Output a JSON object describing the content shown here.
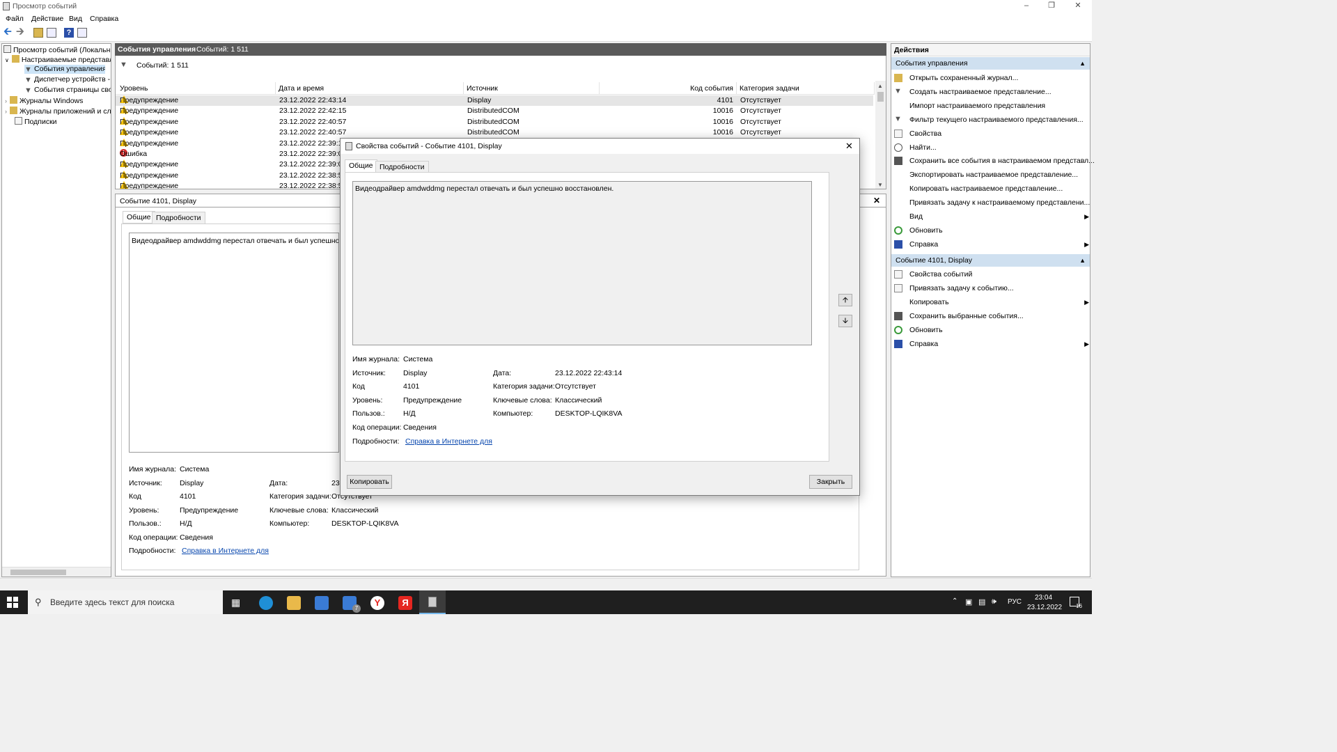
{
  "window": {
    "title": "Просмотр событий"
  },
  "menu": [
    "Файл",
    "Действие",
    "Вид",
    "Справка"
  ],
  "tree": {
    "root": "Просмотр событий (Локальнь",
    "custom_views": "Настраиваемые представле",
    "admin_events": "События управления",
    "device_manager": "Диспетчер устройств - А",
    "page_events": "События страницы свод",
    "windows_logs": "Журналы Windows",
    "app_logs": "Журналы приложений и сл",
    "subscriptions": "Подписки"
  },
  "list": {
    "header_title": "События управления",
    "header_count": "Событий: 1 511",
    "filter_count": "Событий: 1 511",
    "columns": {
      "level": "Уровень",
      "datetime": "Дата и время",
      "source": "Источник",
      "code": "Код события",
      "category": "Категория задачи"
    },
    "rows": [
      {
        "level": "Предупреждение",
        "type": "warn",
        "datetime": "23.12.2022 22:43:14",
        "source": "Display",
        "code": "4101",
        "category": "Отсутствует"
      },
      {
        "level": "Предупреждение",
        "type": "warn",
        "datetime": "23.12.2022 22:42:15",
        "source": "DistributedCOM",
        "code": "10016",
        "category": "Отсутствует"
      },
      {
        "level": "Предупреждение",
        "type": "warn",
        "datetime": "23.12.2022 22:40:57",
        "source": "DistributedCOM",
        "code": "10016",
        "category": "Отсутствует"
      },
      {
        "level": "Предупреждение",
        "type": "warn",
        "datetime": "23.12.2022 22:40:57",
        "source": "DistributedCOM",
        "code": "10016",
        "category": "Отсутствует"
      },
      {
        "level": "Предупреждение",
        "type": "warn",
        "datetime": "23.12.2022 22:39:18",
        "source": "",
        "code": "",
        "category": ""
      },
      {
        "level": "Ошибка",
        "type": "error",
        "datetime": "23.12.2022 22:39:04",
        "source": "",
        "code": "",
        "category": ""
      },
      {
        "level": "Предупреждение",
        "type": "warn",
        "datetime": "23.12.2022 22:39:01",
        "source": "",
        "code": "",
        "category": ""
      },
      {
        "level": "Предупреждение",
        "type": "warn",
        "datetime": "23.12.2022 22:38:58",
        "source": "",
        "code": "",
        "category": ""
      },
      {
        "level": "Предупреждение",
        "type": "warn",
        "datetime": "23.12.2022 22:38:55",
        "source": "",
        "code": "",
        "category": ""
      }
    ]
  },
  "preview": {
    "title": "Событие 4101, Display",
    "tab_general": "Общие",
    "tab_details": "Подробности",
    "message": "Видеодрайвер amdwddmg перестал отвечать и был успешно восс",
    "labels": {
      "log": "Имя журнала:",
      "source": "Источник:",
      "code": "Код",
      "level": "Уровень:",
      "user": "Пользов.:",
      "opcode": "Код операции:",
      "details": "Подробности:",
      "date": "Дата:",
      "category": "Категория задачи:",
      "keywords": "Ключевые слова:",
      "computer": "Компьютер:"
    },
    "values": {
      "log": "Система",
      "source": "Display",
      "code": "4101",
      "level": "Предупреждение",
      "user": "Н/Д",
      "opcode": "Сведения",
      "details_link": "Справка в Интернете для ",
      "date": "23",
      "category": "Отсутствует",
      "keywords": "Классический",
      "computer": "DESKTOP-LQIK8VA"
    }
  },
  "dialog": {
    "title": "Свойства событий - Событие 4101, Display",
    "tab_general": "Общие",
    "tab_details": "Подробности",
    "message": "Видеодрайвер amdwddmg перестал отвечать и был успешно восстановлен.",
    "labels": {
      "log": "Имя журнала:",
      "source": "Источник:",
      "code": "Код",
      "level": "Уровень:",
      "user": "Пользов.:",
      "opcode": "Код операции:",
      "details": "Подробности:",
      "date": "Дата:",
      "category": "Категория задачи:",
      "keywords": "Ключевые слова:",
      "computer": "Компьютер:"
    },
    "values": {
      "log": "Система",
      "source": "Display",
      "code": "4101",
      "level": "Предупреждение",
      "user": "Н/Д",
      "opcode": "Сведения",
      "details_link": "Справка в Интернете для ",
      "date": "23.12.2022 22:43:14",
      "category": "Отсутствует",
      "keywords": "Классический",
      "computer": "DESKTOP-LQIK8VA"
    },
    "copy_button": "Копировать",
    "close_button": "Закрыть"
  },
  "actions": {
    "header": "Действия",
    "section1": "События управления",
    "items1": [
      {
        "label": "Открыть сохраненный журнал...",
        "icon": "folder-icon",
        "arrow": false
      },
      {
        "label": "Создать настраиваемое представление...",
        "icon": "filter-icon",
        "arrow": false
      },
      {
        "label": "Импорт настраиваемого представления",
        "icon": "",
        "arrow": false
      },
      {
        "label": "Фильтр текущего настраиваемого представления...",
        "icon": "filter-icon",
        "arrow": false
      },
      {
        "label": "Свойства",
        "icon": "properties-icon",
        "arrow": false
      },
      {
        "label": "Найти...",
        "icon": "find-icon",
        "arrow": false
      },
      {
        "label": "Сохранить все события в настраиваемом представл...",
        "icon": "save-icon",
        "arrow": false
      },
      {
        "label": "Экспортировать настраиваемое представление...",
        "icon": "",
        "arrow": false
      },
      {
        "label": "Копировать настраиваемое представление...",
        "icon": "",
        "arrow": false
      },
      {
        "label": "Привязать задачу к настраиваемому представлени...",
        "icon": "",
        "arrow": false
      },
      {
        "label": "Вид",
        "icon": "",
        "arrow": true
      },
      {
        "label": "Обновить",
        "icon": "refresh-icon",
        "arrow": false
      },
      {
        "label": "Справка",
        "icon": "help-icon",
        "arrow": true
      }
    ],
    "section2": "Событие 4101, Display",
    "items2": [
      {
        "label": "Свойства событий",
        "icon": "properties-icon",
        "arrow": false
      },
      {
        "label": "Привязать задачу к событию...",
        "icon": "task-icon",
        "arrow": false
      },
      {
        "label": "Копировать",
        "icon": "",
        "arrow": true
      },
      {
        "label": "Сохранить выбранные события...",
        "icon": "save-icon",
        "arrow": false
      },
      {
        "label": "Обновить",
        "icon": "refresh-icon",
        "arrow": false
      },
      {
        "label": "Справка",
        "icon": "help-icon",
        "arrow": true
      }
    ]
  },
  "taskbar": {
    "search_placeholder": "Введите здесь текст для поиска",
    "mail_badge": "7",
    "lang": "РУС",
    "time": "23:04",
    "date": "23.12.2022",
    "notif": "16"
  }
}
